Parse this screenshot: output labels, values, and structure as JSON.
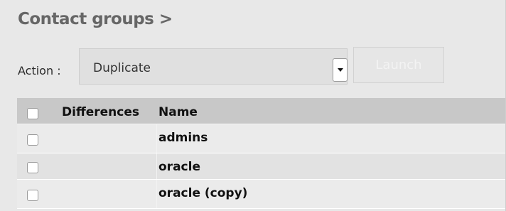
{
  "header": {
    "title": "Contact groups >"
  },
  "toolbar": {
    "action_label": "Action :",
    "action_value": "Duplicate",
    "launch_label": "Launch"
  },
  "table": {
    "columns": [
      "Differences",
      "Name"
    ],
    "rows": [
      {
        "differences": "",
        "name": "admins"
      },
      {
        "differences": "",
        "name": "oracle"
      },
      {
        "differences": "",
        "name": "oracle (copy)"
      }
    ]
  }
}
